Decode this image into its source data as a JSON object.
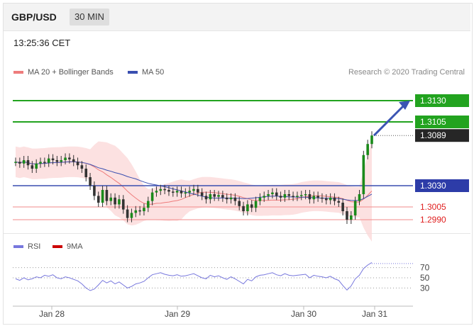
{
  "header": {
    "pair": "GBP/USD",
    "timeframe": "30 MIN"
  },
  "timestamp": "13:25:36 CET",
  "legend": {
    "ma20": {
      "label": "MA 20 + Bollinger Bands",
      "color": "#ee7c7c"
    },
    "ma50": {
      "label": "MA 50",
      "color": "#3a4fb0"
    }
  },
  "credit": "Research © 2020 Trading Central",
  "rsi_legend": {
    "rsi": {
      "label": "RSI",
      "color": "#7777dd"
    },
    "ma9": {
      "label": "9MA",
      "color": "#cc0000"
    }
  },
  "chart_data": [
    {
      "type": "line",
      "name": "price",
      "x_labels": [
        "Jan 28",
        "Jan 29",
        "Jan 30",
        "Jan 31"
      ],
      "ylim": [
        1.2975,
        1.315
      ],
      "levels": [
        {
          "value": 1.313,
          "label": "1.3130",
          "kind": "target"
        },
        {
          "value": 1.3105,
          "label": "1.3105",
          "kind": "resistance"
        },
        {
          "value": 1.3089,
          "label": "1.3089",
          "kind": "last"
        },
        {
          "value": 1.303,
          "label": "1.3030",
          "kind": "pivot"
        },
        {
          "value": 1.3005,
          "label": "1.3005",
          "kind": "support"
        },
        {
          "value": 1.299,
          "label": "1.2990",
          "kind": "support"
        }
      ],
      "close": [
        1.3058,
        1.3056,
        1.306,
        1.3054,
        1.305,
        1.3056,
        1.3058,
        1.3057,
        1.3062,
        1.306,
        1.3058,
        1.306,
        1.3063,
        1.3061,
        1.3058,
        1.3054,
        1.305,
        1.304,
        1.303,
        1.3018,
        1.301,
        1.3025,
        1.3012,
        1.3016,
        1.3008,
        1.3014,
        1.3002,
        1.2992,
        1.2998,
        1.3001,
        1.3,
        1.3004,
        1.3012,
        1.3022,
        1.3024,
        1.3026,
        1.3025,
        1.3023,
        1.3022,
        1.3024,
        1.3021,
        1.3022,
        1.3024,
        1.3026,
        1.3022,
        1.3018,
        1.3014,
        1.302,
        1.3017,
        1.3019,
        1.3016,
        1.3014,
        1.3016,
        1.3012,
        1.3006,
        1.3,
        1.3008,
        1.3004,
        1.3012,
        1.3016,
        1.3018,
        1.302,
        1.3022,
        1.3018,
        1.3016,
        1.302,
        1.3018,
        1.3017,
        1.3018,
        1.3019,
        1.302,
        1.3014,
        1.3018,
        1.3016,
        1.3015,
        1.3013,
        1.3016,
        1.3012,
        1.301,
        1.3,
        1.299,
        1.2995,
        1.3012,
        1.302,
        1.3066,
        1.3079,
        1.3089
      ]
    },
    {
      "type": "line",
      "name": "RSI",
      "ylim": [
        0,
        100
      ],
      "ticks": [
        30,
        50,
        70
      ],
      "rsi": [
        48,
        45,
        50,
        46,
        48,
        52,
        50,
        55,
        53,
        56,
        50,
        48,
        52,
        50,
        47,
        44,
        38,
        30,
        25,
        28,
        36,
        45,
        40,
        44,
        38,
        42,
        36,
        30,
        33,
        38,
        40,
        43,
        50,
        56,
        58,
        60,
        57,
        55,
        54,
        56,
        53,
        54,
        56,
        58,
        54,
        50,
        48,
        55,
        52,
        54,
        50,
        47,
        52,
        48,
        43,
        38,
        47,
        44,
        52,
        55,
        56,
        58,
        60,
        56,
        54,
        58,
        55,
        54,
        55,
        56,
        57,
        50,
        55,
        53,
        52,
        50,
        53,
        48,
        45,
        35,
        26,
        34,
        48,
        55,
        68,
        75,
        80
      ],
      "upper_dotted": 78
    }
  ]
}
